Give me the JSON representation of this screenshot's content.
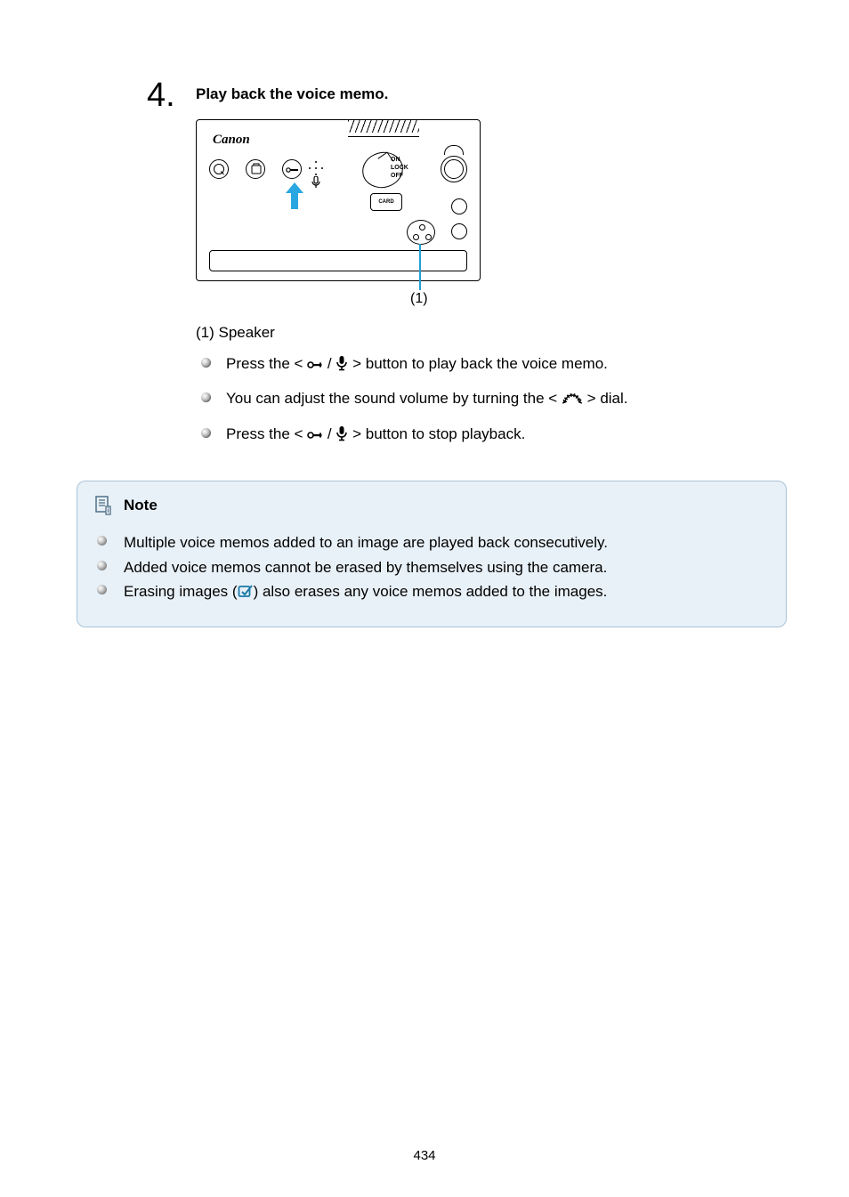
{
  "step": {
    "number": "4",
    "dot": ".",
    "title": "Play back the voice memo."
  },
  "illustration": {
    "brand": "Canon",
    "power_on": "ON",
    "power_lock": "LOCK",
    "power_off": "OFF",
    "card": "CARD",
    "callout_label": "(1)"
  },
  "speaker_caption": "(1) Speaker",
  "bullets": {
    "b1_a": "Press the < ",
    "b1_b": " / ",
    "b1_c": " > button to play back the voice memo.",
    "b2_a": "You can adjust the sound volume by turning the < ",
    "b2_b": " > dial.",
    "b3_a": "Press the < ",
    "b3_b": " / ",
    "b3_c": " > button to stop playback."
  },
  "note": {
    "title": "Note",
    "n1": "Multiple voice memos added to an image are played back consecutively.",
    "n2": "Added voice memos cannot be erased by themselves using the camera.",
    "n3_a": "Erasing images (",
    "n3_b": ") also erases any voice memos added to the images."
  },
  "page_number": "434"
}
